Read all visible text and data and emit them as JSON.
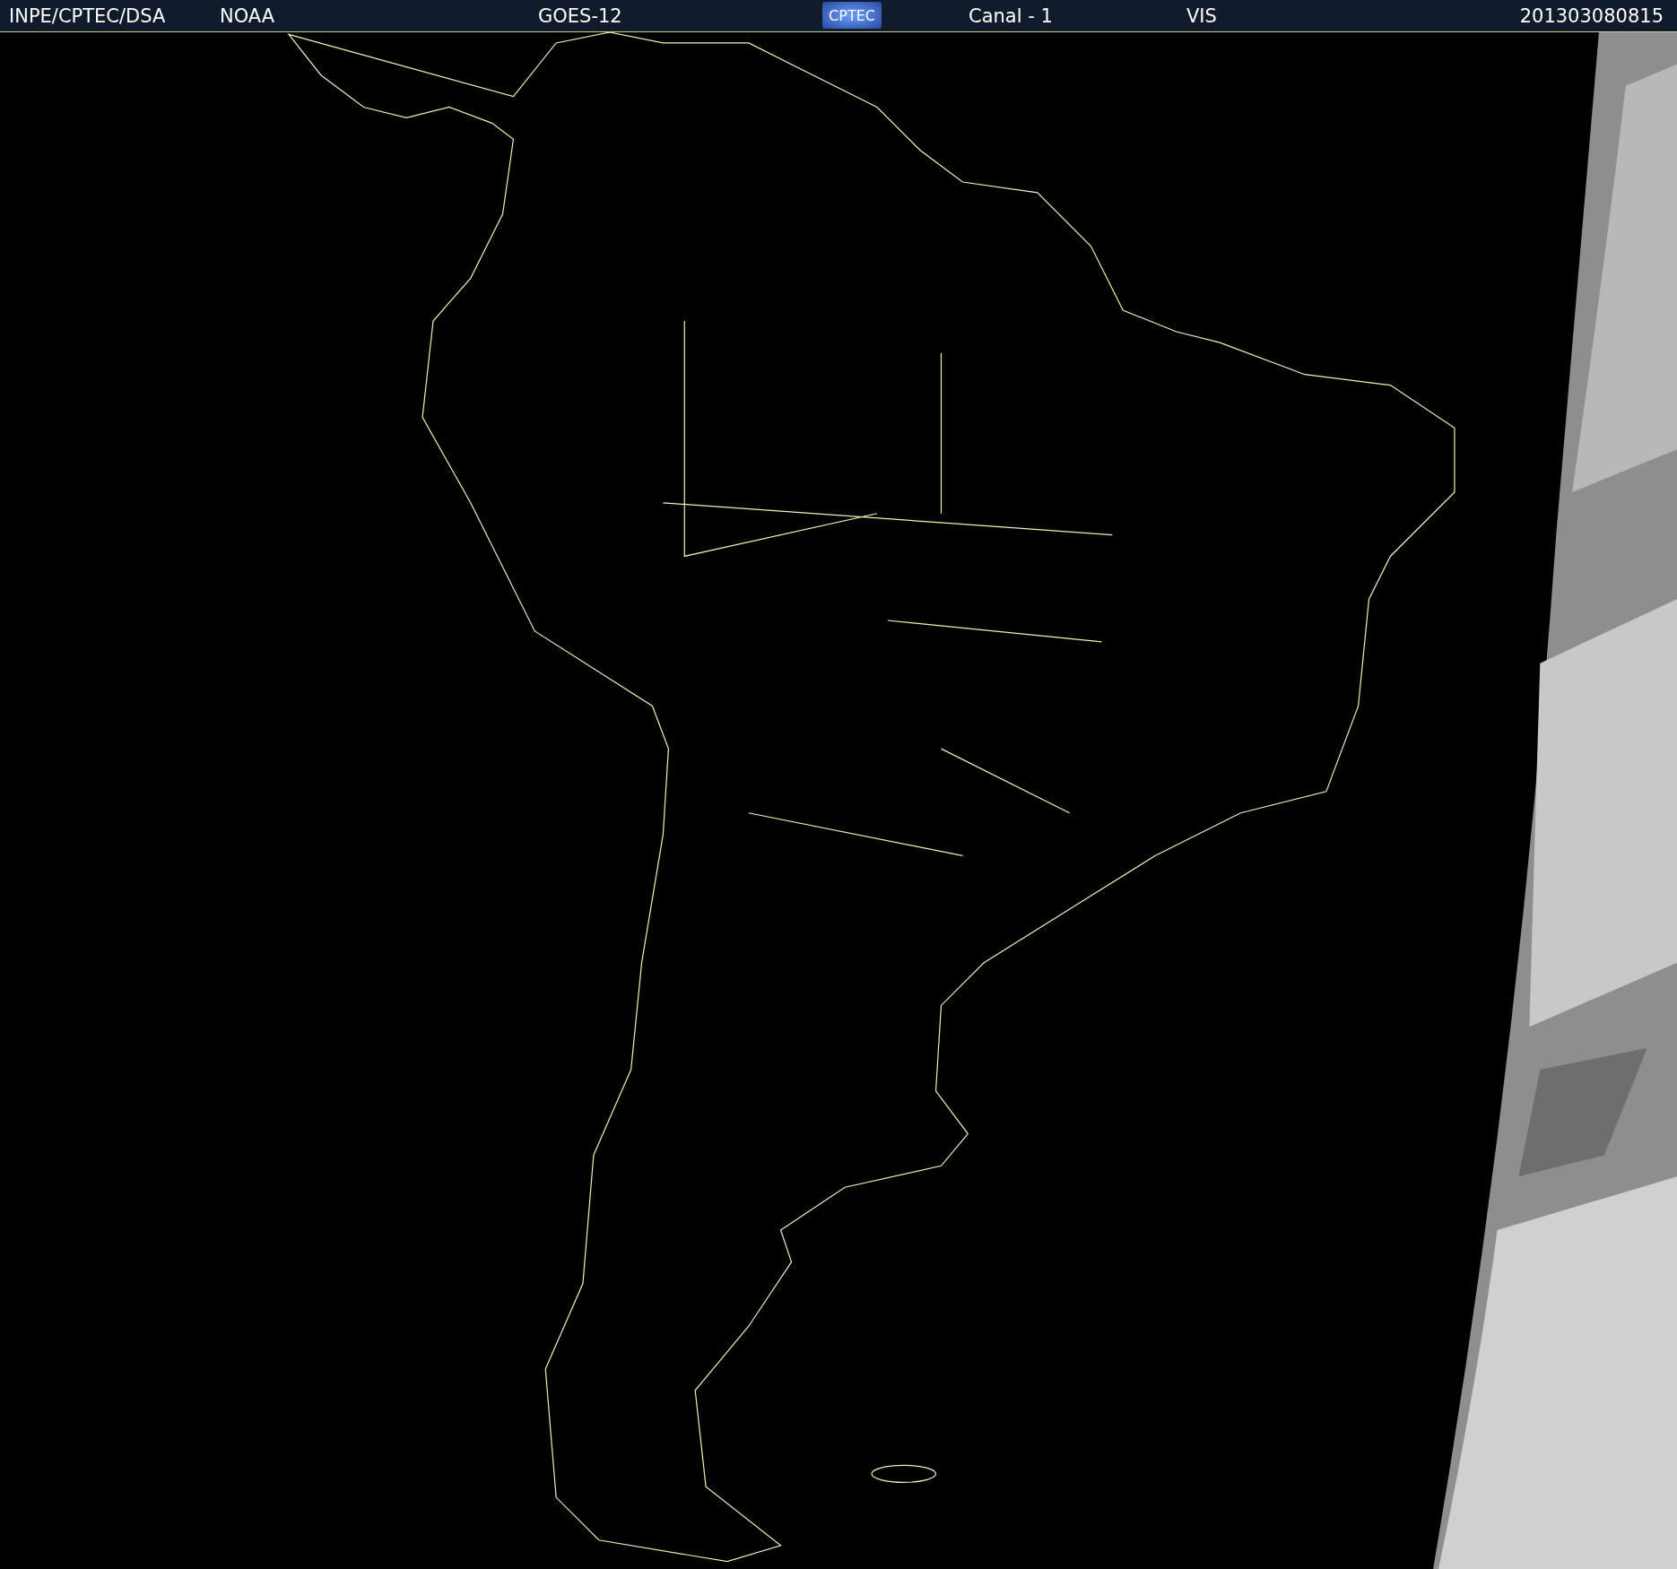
{
  "header": [
    {
      "kind": "text",
      "text": "INPE/CPTEC/DSA"
    },
    {
      "kind": "text",
      "text": "NOAA"
    },
    {
      "kind": "text",
      "text": "GOES-12"
    },
    {
      "kind": "logo",
      "text": "CPTEC"
    },
    {
      "kind": "text",
      "text": "Canal - 1"
    },
    {
      "kind": "text",
      "text": "VIS"
    },
    {
      "kind": "text",
      "text": "201303080815"
    }
  ]
}
